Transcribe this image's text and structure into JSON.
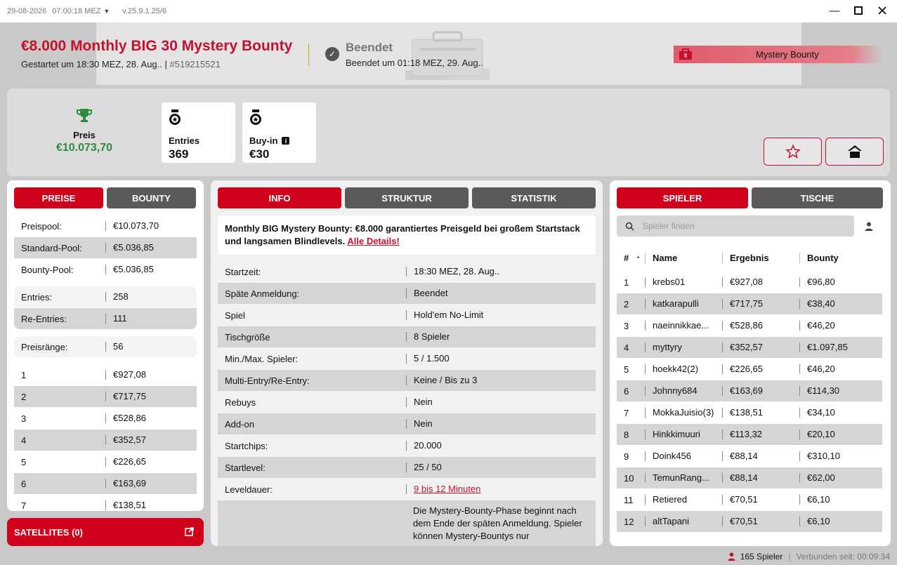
{
  "titlebar": {
    "date": "29-08-2026",
    "time": "07:00:18 MEZ",
    "version": "v.25.9.1.25/6"
  },
  "header": {
    "title": "€8.000 Monthly BIG 30 Mystery Bounty",
    "started": "Gestartet um 18:30 MEZ, 28. Aug..",
    "id": "#519215521",
    "status": "Beendet",
    "status_sub": "Beendet um 01:18 MEZ, 29. Aug..",
    "badge": "Mystery Bounty"
  },
  "summary": {
    "prize_label": "Preis",
    "prize_value": "€10.073,70",
    "entries_label": "Entries",
    "entries_value": "369",
    "buyin_label": "Buy-in",
    "buyin_value": "€30"
  },
  "colors": {
    "accent": "#d0021b",
    "prize": "#2e8b3e"
  },
  "left": {
    "tabs": [
      "PREISE",
      "BOUNTY"
    ],
    "rows": [
      {
        "k": "Preispool:",
        "v": "€10.073,70"
      },
      {
        "k": "Standard-Pool:",
        "v": "€5.036,85"
      },
      {
        "k": "Bounty-Pool:",
        "v": "€5.036,85"
      },
      {
        "k": "Entries:",
        "v": "258"
      },
      {
        "k": "Re-Entries:",
        "v": "111"
      },
      {
        "k": "Preisränge:",
        "v": "56"
      },
      {
        "k": "1",
        "v": "€927,08"
      },
      {
        "k": "2",
        "v": "€717,75"
      },
      {
        "k": "3",
        "v": "€528,86"
      },
      {
        "k": "4",
        "v": "€352,57"
      },
      {
        "k": "5",
        "v": "€226,65"
      },
      {
        "k": "6",
        "v": "€163,69"
      },
      {
        "k": "7",
        "v": "€138,51"
      }
    ],
    "satellites": "SATELLITES (0)"
  },
  "center": {
    "tabs": [
      "INFO",
      "STRUKTUR",
      "STATISTIK"
    ],
    "description": "Monthly BIG Mystery Bounty: €8.000 garantiertes Preisgeld bei großem Startstack und langsamen Blindlevels.",
    "details_link": "Alle Details!",
    "rows": [
      {
        "k": "Startzeit:",
        "v": "18:30 MEZ, 28. Aug.."
      },
      {
        "k": "Späte Anmeldung:",
        "v": "Beendet"
      },
      {
        "k": "Spiel",
        "v": "Hold'em No-Limit"
      },
      {
        "k": "Tischgröße",
        "v": "8 Spieler"
      },
      {
        "k": "Min./Max. Spieler:",
        "v": "5 / 1.500"
      },
      {
        "k": "Multi-Entry/Re-Entry:",
        "v": "Keine / Bis zu 3"
      },
      {
        "k": "Rebuys",
        "v": "Nein"
      },
      {
        "k": "Add-on",
        "v": "Nein"
      },
      {
        "k": "Startchips:",
        "v": "20.000"
      },
      {
        "k": "Startlevel:",
        "v": "25 / 50"
      },
      {
        "k": "Leveldauer:",
        "v": "9 bis 12 Minuten"
      },
      {
        "k": "",
        "v": "Die Mystery-Bounty-Phase beginnt nach dem Ende der späten Anmeldung. Spieler können Mystery-Bountys nur"
      }
    ]
  },
  "right": {
    "tabs": [
      "SPIELER",
      "TISCHE"
    ],
    "search_placeholder": "Spieler finden",
    "headers": [
      "#",
      "Name",
      "Ergebnis",
      "Bounty"
    ],
    "rows": [
      {
        "n": "1",
        "name": "krebs01",
        "res": "€927,08",
        "bounty": "€96,80"
      },
      {
        "n": "2",
        "name": "katkarapulli",
        "res": "€717,75",
        "bounty": "€38,40"
      },
      {
        "n": "3",
        "name": "naeinnikkae...",
        "res": "€528,86",
        "bounty": "€46,20"
      },
      {
        "n": "4",
        "name": "myttyry",
        "res": "€352,57",
        "bounty": "€1.097,85"
      },
      {
        "n": "5",
        "name": "hoekk42(2)",
        "res": "€226,65",
        "bounty": "€46,20"
      },
      {
        "n": "6",
        "name": "Johnny684",
        "res": "€163,69",
        "bounty": "€114,30"
      },
      {
        "n": "7",
        "name": "MokkaJuisio(3)",
        "res": "€138,51",
        "bounty": "€34,10"
      },
      {
        "n": "8",
        "name": "Hinkkimuuri",
        "res": "€113,32",
        "bounty": "€20,10"
      },
      {
        "n": "9",
        "name": "Doink456",
        "res": "€88,14",
        "bounty": "€310,10"
      },
      {
        "n": "10",
        "name": "TemunRang...",
        "res": "€88,14",
        "bounty": "€62,00"
      },
      {
        "n": "11",
        "name": "Retiered",
        "res": "€70,51",
        "bounty": "€6,10"
      },
      {
        "n": "12",
        "name": "altTapani",
        "res": "€70,51",
        "bounty": "€6,10"
      }
    ]
  },
  "footer": {
    "players": "165 Spieler",
    "connected": "Verbunden seit: 00:09:34"
  }
}
